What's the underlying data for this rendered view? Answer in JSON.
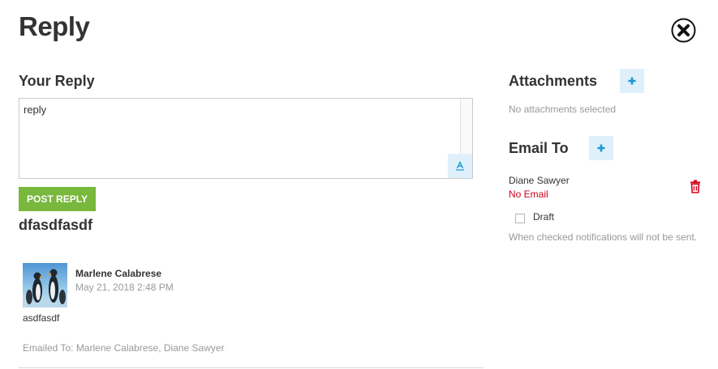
{
  "title": "Reply",
  "reply_section": {
    "heading": "Your Reply",
    "textarea_value": "reply",
    "post_label": "POST REPLY"
  },
  "thread": {
    "subject": "dfasdfasdf",
    "message": {
      "author": "Marlene Calabrese",
      "date": "May 21, 2018 2:48 PM",
      "body": "asdfasdf",
      "emailed_to": "Emailed To: Marlene Calabrese, Diane Sawyer"
    }
  },
  "attachments": {
    "heading": "Attachments",
    "empty_text": "No attachments selected"
  },
  "email_to": {
    "heading": "Email To",
    "recipients": [
      {
        "name": "Diane Sawyer",
        "status": "No Email"
      }
    ]
  },
  "draft": {
    "label": "Draft",
    "checked": false,
    "note": "When checked notifications will not be sent."
  },
  "colors": {
    "accent_blue": "#1a9ad6",
    "accent_blue_bg": "#dff0fa",
    "post_button": "#78b83d",
    "error": "#d0021b"
  },
  "icons": [
    "close-icon",
    "text-format-icon",
    "plus-icon",
    "trash-icon"
  ]
}
